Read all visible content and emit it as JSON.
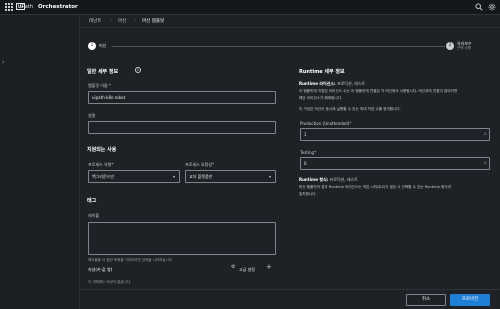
{
  "header": {
    "brand": "Path",
    "logo_text": "Ui",
    "product": "Orchestrator",
    "icons": [
      "apps-grid-icon",
      "search-icon",
      "settings-icon"
    ]
  },
  "breadcrumb": [
    "테넌트",
    "머신",
    "머신 템플릿"
  ],
  "stepper": {
    "step1": {
      "num": "1",
      "label": "머신"
    },
    "step2": {
      "num": "2",
      "label": "유지보수",
      "sub": "선택 사항"
    }
  },
  "general": {
    "title": "일반 세부 정보",
    "template_name_label": "템플릿 이름 *",
    "template_name_value": "uipath-k8s-robot",
    "description_label": "설명",
    "description_value": ""
  },
  "supported": {
    "title": "지원되는 사용",
    "process_type_label": "프로세스 유형*",
    "process_type_value": "백그라운드만",
    "process_compat_label": "프로세스 호환성*",
    "process_compat_value": "교차 플랫폼만"
  },
  "tags": {
    "title": "태그",
    "labels_label": "레이블",
    "labels_hint": "레이블을 이 옵션 목록을 가져오려면 입력을 시작하십시오.",
    "props_title": "속성(키-값 쌍)",
    "advanced_label": "고급 설정",
    "empty_text": "이 개체에는 속성이 없습니다."
  },
  "runtime": {
    "title": "Runtime 세부 정보",
    "p1_bold": "Runtime 라이선스:",
    "p1_rest": "프로덕션, 테스트",
    "p1_line2": "이 템플릿에 지정된 라이선스 수는 이 템플릿에 연결된 각 머신에서 사용됩니다. 머신과의 연결이 끊어지면",
    "p1_line3": "해당 라이선스가 해제됩니다.",
    "p2": "이 구성은 머신이 동시에 실행할 수 있는 최대 작업 수를 정의합니다.",
    "prod_label": "Production (Unattended)*",
    "prod_value": "1",
    "prod_suffix": "/1",
    "testing_label": "Testing*",
    "testing_value": "0",
    "testing_suffix": "/1",
    "slots_bold": "Runtime 형식:",
    "slots_rest": "프로덕션, 테스트",
    "slots_line2": "머신 템플릿의 경우 Runtime 라이선스는 작업 시작/트리거 생성 시 선택할 수 있는 Runtime 형식과",
    "slots_line3": "일치합니다."
  },
  "footer": {
    "cancel": "취소",
    "provision": "프로비전"
  }
}
